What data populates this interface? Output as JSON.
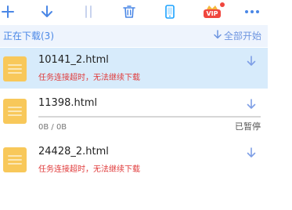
{
  "toolbar": {
    "buttons": [
      {
        "icon": "plus-icon",
        "color": "#4a87e6"
      },
      {
        "icon": "download-arrow-icon",
        "color": "#4a87e6"
      },
      {
        "icon": "pause-icon",
        "color": "#c8d3ee"
      },
      {
        "icon": "trash-icon",
        "color": "#4a87e6"
      },
      {
        "icon": "phone-icon",
        "color": "#1aa2ff"
      },
      {
        "icon": "vip-crown-icon",
        "badge": "VIP",
        "color": "#f0463e"
      },
      {
        "icon": "more-icon",
        "color": "#4a87e6"
      }
    ],
    "vip_label": "VIP"
  },
  "section": {
    "title": "正在下载(3)",
    "start_all_label": "全部开始",
    "accent": "#4a87e6"
  },
  "tasks": [
    {
      "name": "10141_2.html",
      "error": "任务连接超时，无法继续下载",
      "selected": true
    },
    {
      "name": "11398.html",
      "size": "0B / 0B",
      "status": "已暂停",
      "progress": 0
    },
    {
      "name": "24428_2.html",
      "error": "任务连接超时，无法继续下载",
      "selected": false
    }
  ]
}
